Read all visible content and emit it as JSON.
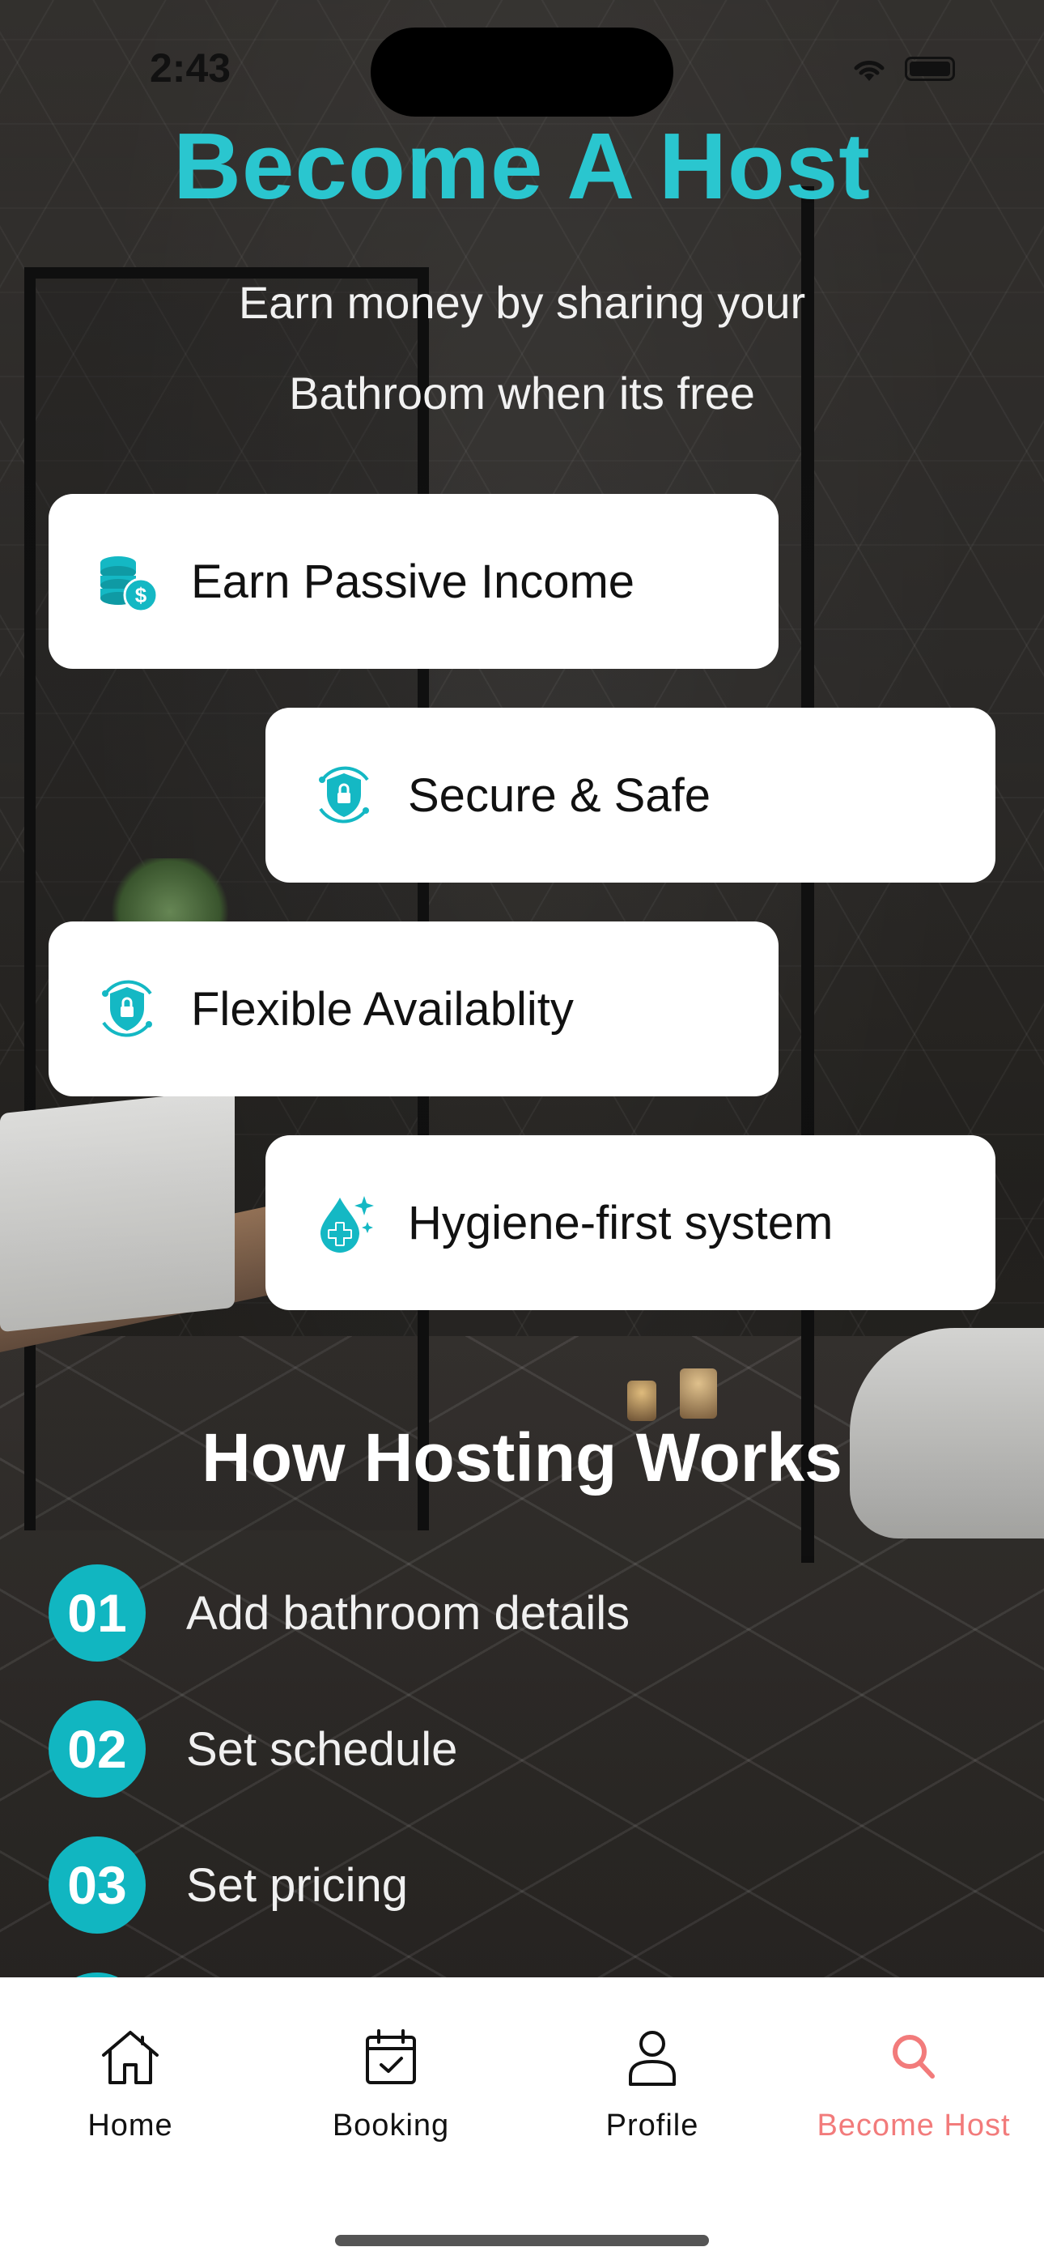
{
  "status_bar": {
    "time": "2:43"
  },
  "header": {
    "title": "Become A Host",
    "subtitle": "Earn money by sharing your Bathroom when its free"
  },
  "features": [
    {
      "label": "Earn Passive Income",
      "icon": "coins-dollar-icon"
    },
    {
      "label": "Secure & Safe",
      "icon": "shield-lock-icon"
    },
    {
      "label": "Flexible Availablity",
      "icon": "shield-lock-icon"
    },
    {
      "label": "Hygiene-first system",
      "icon": "hygiene-drop-icon"
    }
  ],
  "how_it_works": {
    "title": "How Hosting Works",
    "steps": [
      {
        "number": "01",
        "label": "Add bathroom details"
      },
      {
        "number": "02",
        "label": "Set schedule"
      },
      {
        "number": "03",
        "label": "Set pricing"
      }
    ]
  },
  "tabbar": {
    "items": [
      {
        "label": "Home",
        "icon": "home-icon"
      },
      {
        "label": "Booking",
        "icon": "calendar-check-icon"
      },
      {
        "label": "Profile",
        "icon": "user-icon"
      },
      {
        "label": "Become Host",
        "icon": "search-icon",
        "active": true
      }
    ]
  },
  "colors": {
    "accent": "#2ac6cf",
    "step_badge": "#11b6c1",
    "active_tab": "#f27b7b"
  }
}
